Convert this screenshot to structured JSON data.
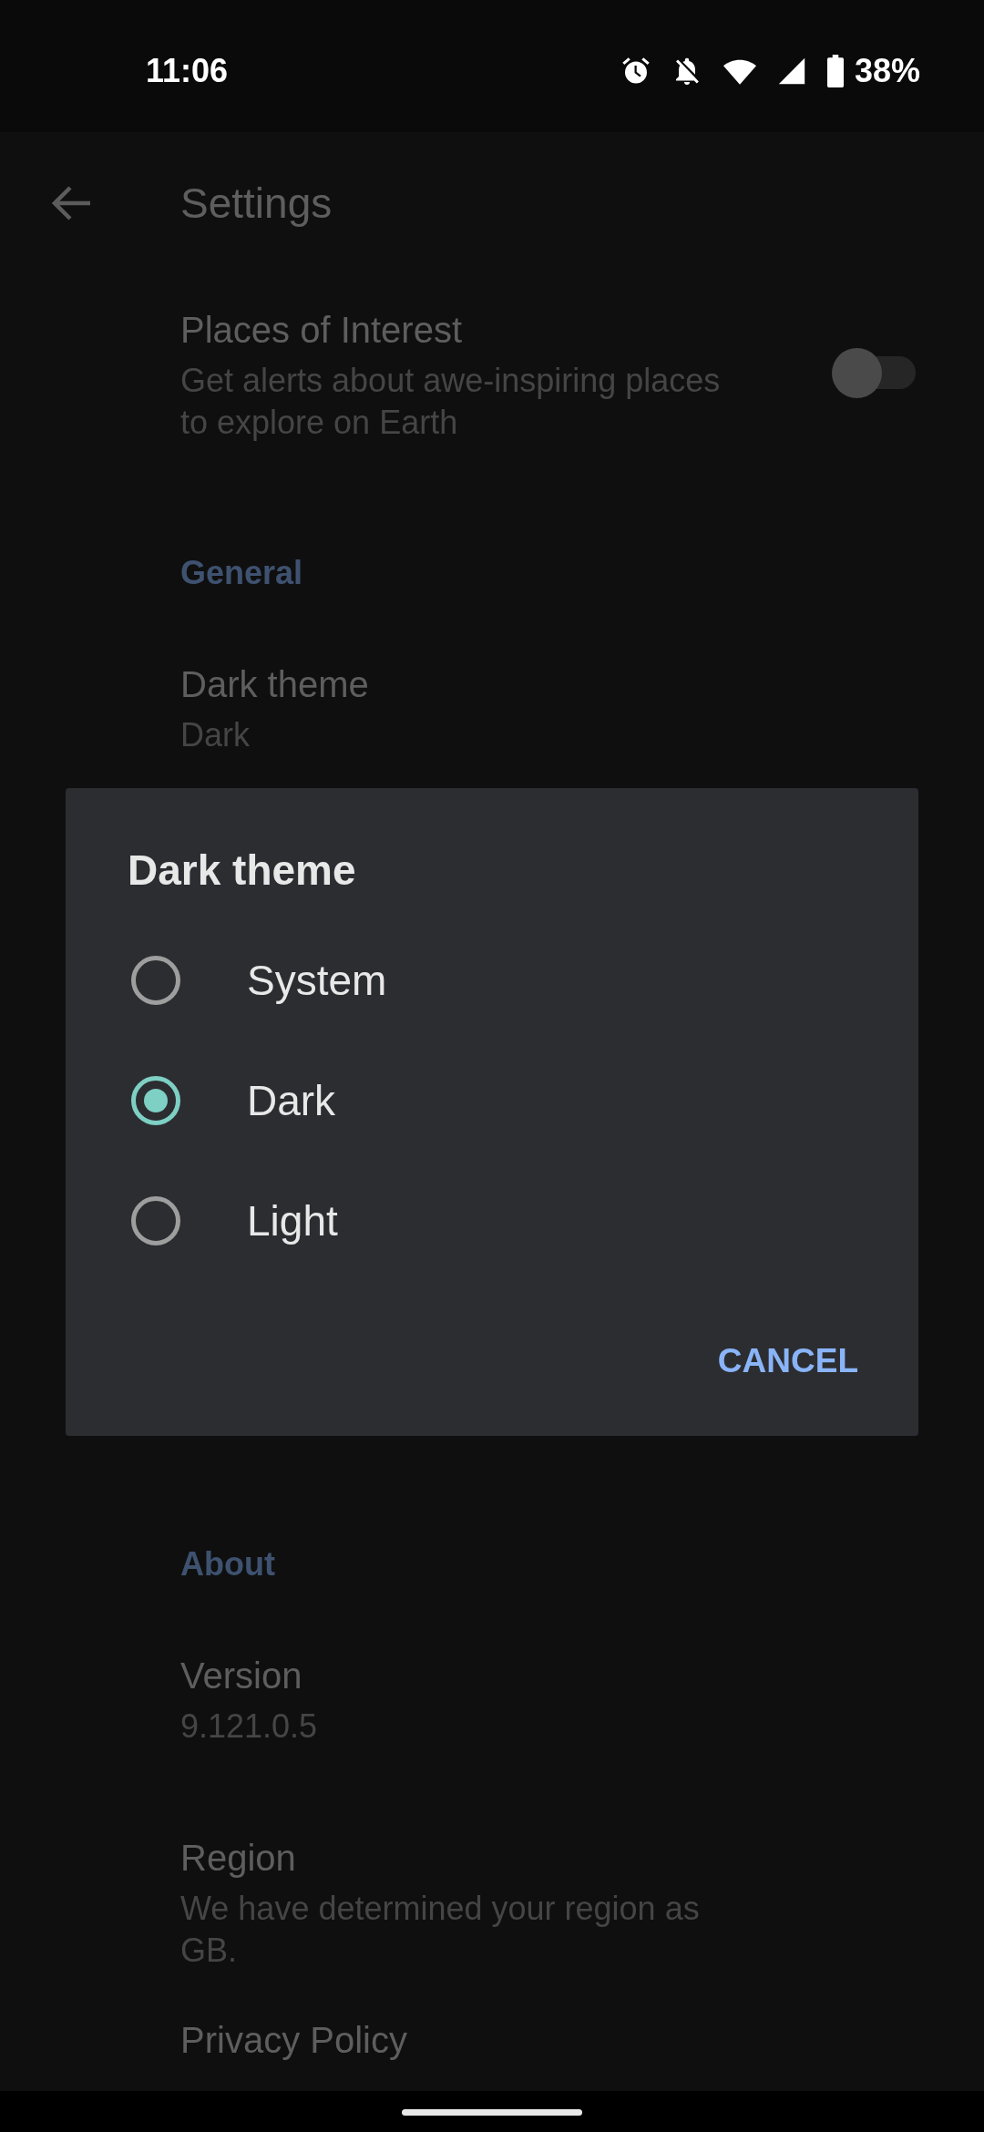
{
  "status_bar": {
    "time": "11:06",
    "battery_text": "38%"
  },
  "app_bar": {
    "title": "Settings"
  },
  "top_list": [
    {
      "kind": "switch",
      "title": "Places of Interest",
      "summary": "Get alerts about awe-inspiring places to explore on Earth",
      "on": false
    },
    {
      "kind": "header",
      "title": "General"
    },
    {
      "kind": "item",
      "title": "Dark theme",
      "summary": "Dark"
    }
  ],
  "bottom_list": [
    {
      "kind": "header",
      "title": "About"
    },
    {
      "kind": "item",
      "title": "Version",
      "summary": "9.121.0.5"
    },
    {
      "kind": "item",
      "title": "Region",
      "summary": "We have determined your region as GB."
    },
    {
      "kind": "item",
      "title": "Privacy Policy"
    }
  ],
  "dialog": {
    "title": "Dark theme",
    "options": [
      {
        "label": "System",
        "selected": false
      },
      {
        "label": "Dark",
        "selected": true
      },
      {
        "label": "Light",
        "selected": false
      }
    ],
    "button": "CANCEL"
  }
}
